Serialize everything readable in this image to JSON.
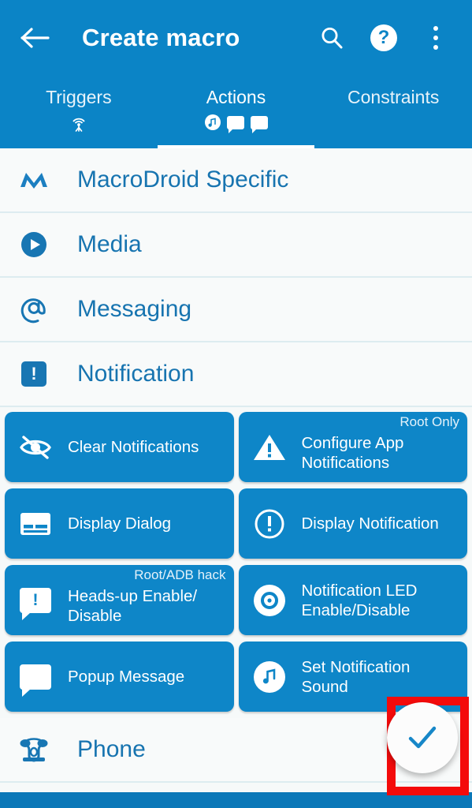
{
  "appbar": {
    "back_icon": "arrow-left-icon",
    "title": "Create macro",
    "search_icon": "search-icon",
    "help_label": "?",
    "help_icon": "help-circle-icon",
    "overflow_icon": "more-vertical-icon",
    "background_color": "#0B84C6"
  },
  "tabs": [
    {
      "label": "Triggers",
      "active": false,
      "icons": [
        "broadcast-tower-icon"
      ]
    },
    {
      "label": "Actions",
      "active": true,
      "icons": [
        "music-note-circle-icon",
        "speech-bubble-icon",
        "speech-bubble-icon"
      ]
    },
    {
      "label": "Constraints",
      "active": false,
      "icons": []
    }
  ],
  "categories": [
    {
      "label": "MacroDroid Specific",
      "icon": "macrodroid-m-logo-icon"
    },
    {
      "label": "Media",
      "icon": "play-circle-icon"
    },
    {
      "label": "Messaging",
      "icon": "at-sign-icon"
    },
    {
      "label": "Notification",
      "icon": "notification-exclamation-icon"
    },
    {
      "label": "Phone",
      "icon": "telephone-icon"
    }
  ],
  "notification_actions": [
    {
      "label": "Clear Notifications",
      "icon": "eye-off-icon",
      "badge": ""
    },
    {
      "label": "Configure App Notifications",
      "icon": "warning-triangle-icon",
      "badge": "Root Only"
    },
    {
      "label": "Display Dialog",
      "icon": "dialog-card-icon",
      "badge": ""
    },
    {
      "label": "Display Notification",
      "icon": "exclamation-circle-icon",
      "badge": ""
    },
    {
      "label": "Heads-up Enable/ Disable",
      "icon": "speech-bubble-exclamation-icon",
      "badge": "Root/ADB hack"
    },
    {
      "label": "Notification LED Enable/Disable",
      "icon": "led-dot-circle-icon",
      "badge": ""
    },
    {
      "label": "Popup Message",
      "icon": "speech-bubble-icon",
      "badge": ""
    },
    {
      "label": "Set Notification Sound",
      "icon": "music-note-circle-icon",
      "badge": ""
    }
  ],
  "fab": {
    "icon": "checkmark-icon",
    "accent_color": "#1787C8"
  },
  "annotation": {
    "highlight_color": "#F40B0B",
    "target": "confirm-fab"
  },
  "colors": {
    "primary": "#0B84C6",
    "card": "#0E86C8",
    "list_background": "#F8FAFA",
    "divider": "#DDECF0",
    "category_text": "#1774B0",
    "bottom_nav": "#0B78B8"
  }
}
